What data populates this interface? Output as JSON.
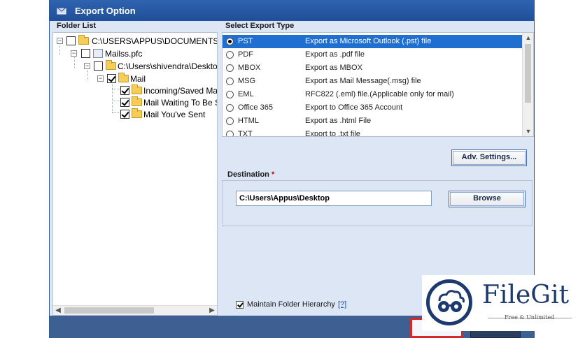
{
  "window": {
    "title": "Export Option"
  },
  "folder_list": {
    "label": "Folder List",
    "nodes": [
      {
        "label": "C:\\USERS\\APPUS\\DOCUMENTS\\DC",
        "checked": false,
        "icon": "open-folder-icon"
      },
      {
        "label": "Mailss.pfc",
        "checked": false,
        "icon": "pst-file-icon"
      },
      {
        "label": "C:\\Users\\shivendra\\Desktop",
        "checked": false,
        "icon": "folder-icon"
      },
      {
        "label": "Mail",
        "checked": true,
        "icon": "folder-icon"
      },
      {
        "label": "Incoming/Saved Mail",
        "checked": true,
        "icon": "folder-icon"
      },
      {
        "label": "Mail Waiting To Be S",
        "checked": true,
        "icon": "folder-icon"
      },
      {
        "label": "Mail You've Sent",
        "checked": true,
        "icon": "folder-icon"
      }
    ]
  },
  "export_type": {
    "label": "Select Export Type",
    "selected": "PST",
    "options": [
      {
        "format": "PST",
        "description": "Export as Microsoft Outlook (.pst) file"
      },
      {
        "format": "PDF",
        "description": "Export as .pdf file"
      },
      {
        "format": "MBOX",
        "description": "Export as MBOX"
      },
      {
        "format": "MSG",
        "description": "Export as Mail Message(.msg) file"
      },
      {
        "format": "EML",
        "description": "RFC822 (.eml) file.(Applicable only for mail)"
      },
      {
        "format": "Office 365",
        "description": "Export to Office 365 Account"
      },
      {
        "format": "HTML",
        "description": "Export as .html File"
      },
      {
        "format": "TXT",
        "description": "Export to .txt file"
      }
    ]
  },
  "adv_settings": {
    "label": "Adv. Settings..."
  },
  "destination": {
    "label": "Destination",
    "required_mark": "*",
    "path": "C:\\Users\\Appus\\Desktop",
    "browse_label": "Browse"
  },
  "hierarchy": {
    "label": "Maintain Folder Hierarchy",
    "help": "[?]",
    "checked": true
  },
  "watermark": {
    "name": "FileGit",
    "tagline": "Free & Unlimited"
  },
  "colors": {
    "title_bar": "#2f63b0",
    "selection": "#1f6fd1",
    "panel": "#dce6f4",
    "bottom_bar": "#3e5f91",
    "brand": "#1c3a6e",
    "highlight_border": "#d62828"
  }
}
